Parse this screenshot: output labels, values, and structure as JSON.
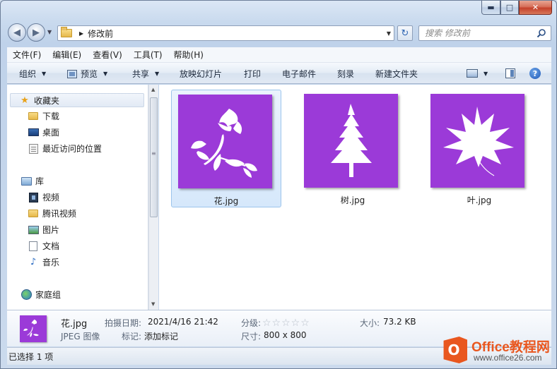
{
  "window": {
    "minimize_glyph": "▬",
    "maximize_glyph": "□",
    "close_glyph": "✕"
  },
  "address": {
    "back_glyph": "◀",
    "forward_glyph": "▶",
    "breadcrumb_arrow": "▶",
    "folder": "修改前",
    "dropdown_glyph": "▼",
    "refresh_glyph": "↻"
  },
  "search": {
    "placeholder": "搜索 修改前"
  },
  "menubar": {
    "items": [
      "文件(F)",
      "编辑(E)",
      "查看(V)",
      "工具(T)",
      "帮助(H)"
    ]
  },
  "toolbar": {
    "organize": "组织",
    "preview": "预览",
    "share": "共享",
    "slideshow": "放映幻灯片",
    "print": "打印",
    "email": "电子邮件",
    "burn": "刻录",
    "new_folder": "新建文件夹",
    "dropdown_glyph": "▼",
    "help_glyph": "?"
  },
  "navpane": {
    "favorites": "收藏夹",
    "downloads": "下载",
    "desktop": "桌面",
    "recent": "最近访问的位置",
    "libraries": "库",
    "videos": "视频",
    "tencent_video": "腾讯视频",
    "pictures": "图片",
    "documents": "文档",
    "music": "音乐",
    "homegroup": "家庭组",
    "scroll_up": "▲",
    "scroll_down": "▼",
    "grip": "≡"
  },
  "files": [
    {
      "name": "花.jpg",
      "selected": true,
      "thumb_color": "#9b3ad8"
    },
    {
      "name": "树.jpg",
      "selected": false,
      "thumb_color": "#9b3ad8"
    },
    {
      "name": "叶.jpg",
      "selected": false,
      "thumb_color": "#9b3ad8"
    }
  ],
  "details": {
    "filename": "花.jpg",
    "type": "JPEG 图像",
    "date_taken_label": "拍摄日期:",
    "date_taken": "2021/4/16 21:42",
    "tags_label": "标记:",
    "tags": "添加标记",
    "rating_label": "分级:",
    "rating_stars": "☆☆☆☆☆",
    "dimensions_label": "尺寸:",
    "dimensions": "800 x 800",
    "size_label": "大小:",
    "size": "73.2 KB"
  },
  "status": {
    "text": "已选择 1 项"
  },
  "watermark": {
    "title": "Office教程网",
    "url": "www.office26.com"
  },
  "colors": {
    "thumbnail_bg": "#9b3ad8",
    "selection": "#d6e8fb",
    "watermark": "#e9571f"
  }
}
